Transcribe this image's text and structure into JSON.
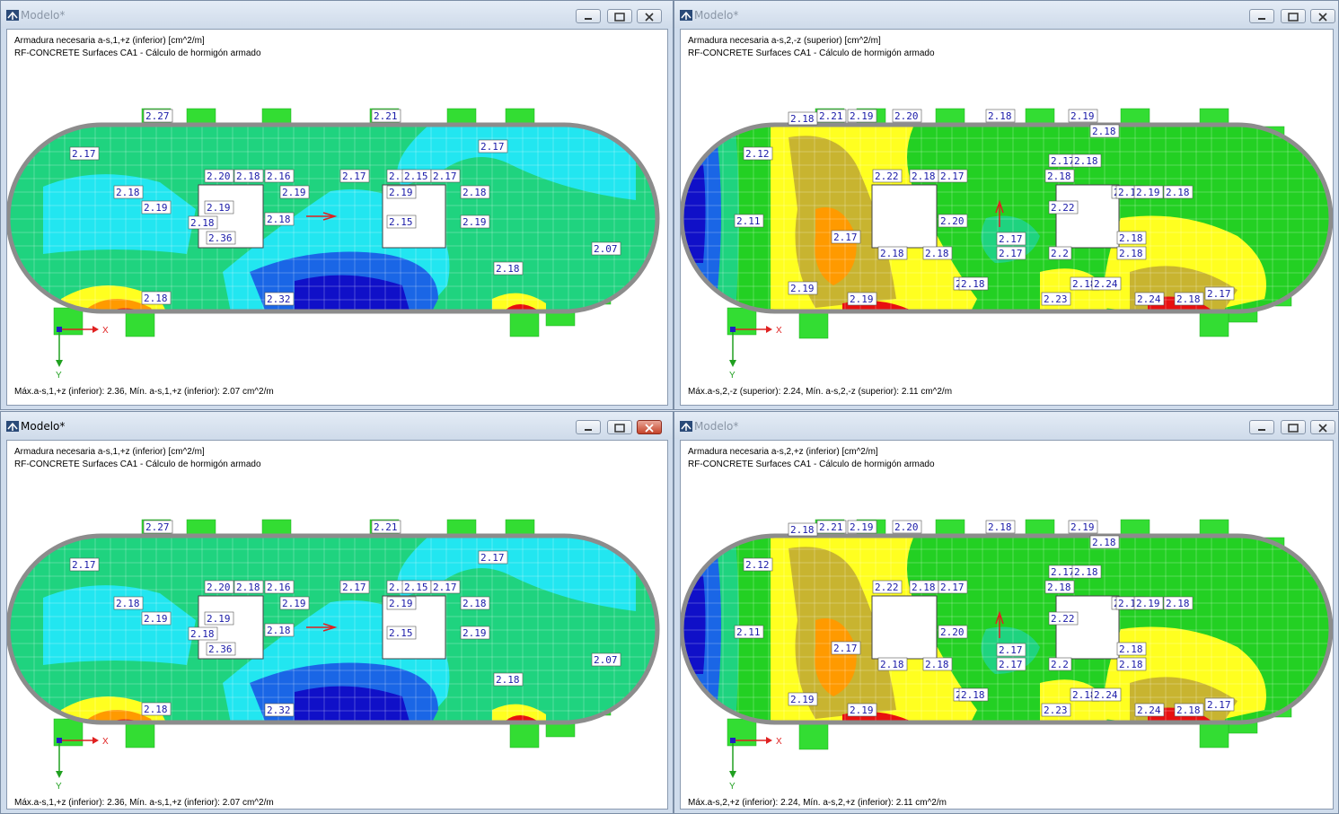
{
  "windows": [
    {
      "title": "Modelo*",
      "header_line1": "Armadura necesaria a-s,1,+z (inferior) [cm^2/m]",
      "header_line2": "RF-CONCRETE Surfaces CA1 - Cálculo de hormigón armado",
      "footer": "Máx.a-s,1,+z (inferior): 2.36, Mín. a-s,1,+z (inferior): 2.07 cm^2/m",
      "labels": [
        "2.27",
        "2.21",
        "2.17",
        "2.17",
        "2.20",
        "2.18",
        "2.16",
        "2.17",
        "2.18",
        "2.15",
        "2.17",
        "2.18",
        "2.19",
        "2.19",
        "2.18",
        "2.19",
        "2.19",
        "2.18",
        "2.15",
        "2.19",
        "2.18",
        "2.36",
        "2.18",
        "2.07",
        "2.18",
        "2.32"
      ]
    },
    {
      "title": "Modelo*",
      "header_line1": "Armadura necesaria a-s,2,-z (superior) [cm^2/m]",
      "header_line2": "RF-CONCRETE Surfaces CA1 - Cálculo de hormigón armado",
      "footer": "Máx.a-s,2,-z (superior): 2.24, Mín. a-s,2,-z (superior): 2.11 cm^2/m",
      "labels": [
        "2.18",
        "2.21",
        "2.19",
        "2.20",
        "2.18",
        "2.19",
        "2.18",
        "2.12",
        "2.22",
        "2.18",
        "2.17",
        "2.17",
        "2.18",
        "2.18",
        "2.11",
        "2.20",
        "2.17",
        "2.19",
        "2.19",
        "2.18",
        "2.22",
        "2.17",
        "2.17",
        "2.18",
        "2.18",
        "2.18",
        "2.17",
        "2.18",
        "2.2",
        "2.19",
        "2.19",
        "2.18",
        "2.18",
        "2.24",
        "2.19",
        "2.23",
        "2.24",
        "2.18",
        "2.17"
      ]
    },
    {
      "title": "Modelo*",
      "header_line1": "Armadura necesaria a-s,1,+z (inferior) [cm^2/m]",
      "header_line2": "RF-CONCRETE Surfaces CA1 - Cálculo de hormigón armado",
      "footer": "Máx.a-s,1,+z (inferior): 2.36, Mín. a-s,1,+z (inferior): 2.07 cm^2/m",
      "labels": [
        "2.27",
        "2.21",
        "2.17",
        "2.17",
        "2.20",
        "2.18",
        "2.16",
        "2.17",
        "2.18",
        "2.15",
        "2.17",
        "2.18",
        "2.19",
        "2.19",
        "2.18",
        "2.19",
        "2.19",
        "2.18",
        "2.15",
        "2.19",
        "2.18",
        "2.36",
        "2.18",
        "2.07",
        "2.18",
        "2.32"
      ]
    },
    {
      "title": "Modelo*",
      "header_line1": "Armadura necesaria a-s,2,+z (inferior) [cm^2/m]",
      "header_line2": "RF-CONCRETE Surfaces CA1 - Cálculo de hormigón armado",
      "footer": "Máx.a-s,2,+z (inferior): 2.24, Mín. a-s,2,+z (inferior): 2.11 cm^2/m",
      "labels": [
        "2.18",
        "2.21",
        "2.19",
        "2.20",
        "2.18",
        "2.19",
        "2.18",
        "2.12",
        "2.22",
        "2.18",
        "2.17",
        "2.17",
        "2.18",
        "2.18",
        "2.11",
        "2.20",
        "2.17",
        "2.19",
        "2.19",
        "2.18",
        "2.22",
        "2.17",
        "2.17",
        "2.18",
        "2.18",
        "2.18",
        "2.17",
        "2.18",
        "2.2",
        "2.19",
        "2.19",
        "2.18",
        "2.18",
        "2.24",
        "2.19",
        "2.23",
        "2.24",
        "2.18",
        "2.17"
      ]
    }
  ],
  "axes": {
    "x": "X",
    "y": "Y"
  },
  "colors": {
    "green": "#23d023",
    "teal": "#1fd37f",
    "cyan": "#22e6f0",
    "blue": "#1a66e6",
    "darkblue": "#1010c8",
    "yellow": "#ffff20",
    "olive": "#c8b430",
    "orange": "#ff9a00",
    "red": "#e81010"
  }
}
